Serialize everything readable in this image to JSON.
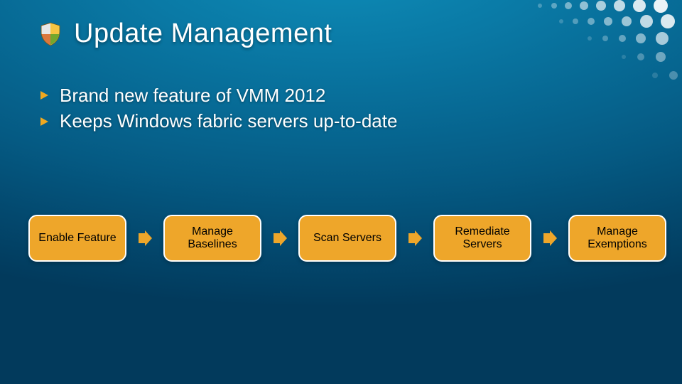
{
  "title": "Update Management",
  "bullets": [
    "Brand new feature of VMM 2012",
    "Keeps Windows fabric servers up-to-date"
  ],
  "flow": [
    "Enable Feature",
    "Manage Baselines",
    "Scan Servers",
    "Remediate Servers",
    "Manage Exemptions"
  ],
  "colors": {
    "accent": "#eea62a",
    "arrow": "#f0a81f"
  }
}
